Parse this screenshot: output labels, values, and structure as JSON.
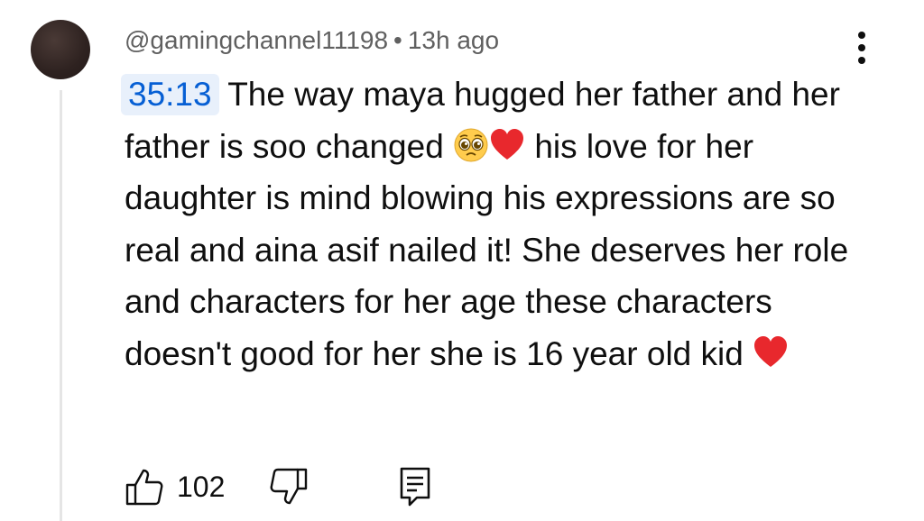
{
  "comment": {
    "author": "@gamingchannel11198",
    "separator": "•",
    "time_ago": "13h ago",
    "timestamp_link": "35:13",
    "text_parts": {
      "part1": " The way maya hugged her father and her father is soo changed ",
      "part2": " his love for her daughter is mind blowing his expressions are so real and aina asif nailed it! She deserves her role and characters for her age these characters doesn't good for her she is 16 year old kid "
    },
    "emojis": [
      "pleading-face",
      "red-heart",
      "red-heart"
    ],
    "like_count": "102",
    "icons": {
      "more": "more-vert-icon",
      "like": "thumb-up-icon",
      "dislike": "thumb-down-icon",
      "reply": "reply-icon"
    },
    "colors": {
      "timestamp_text": "#065fd4",
      "timestamp_bg": "#e8f0fb",
      "meta_text": "#606060",
      "heart": "#e8282d"
    }
  }
}
